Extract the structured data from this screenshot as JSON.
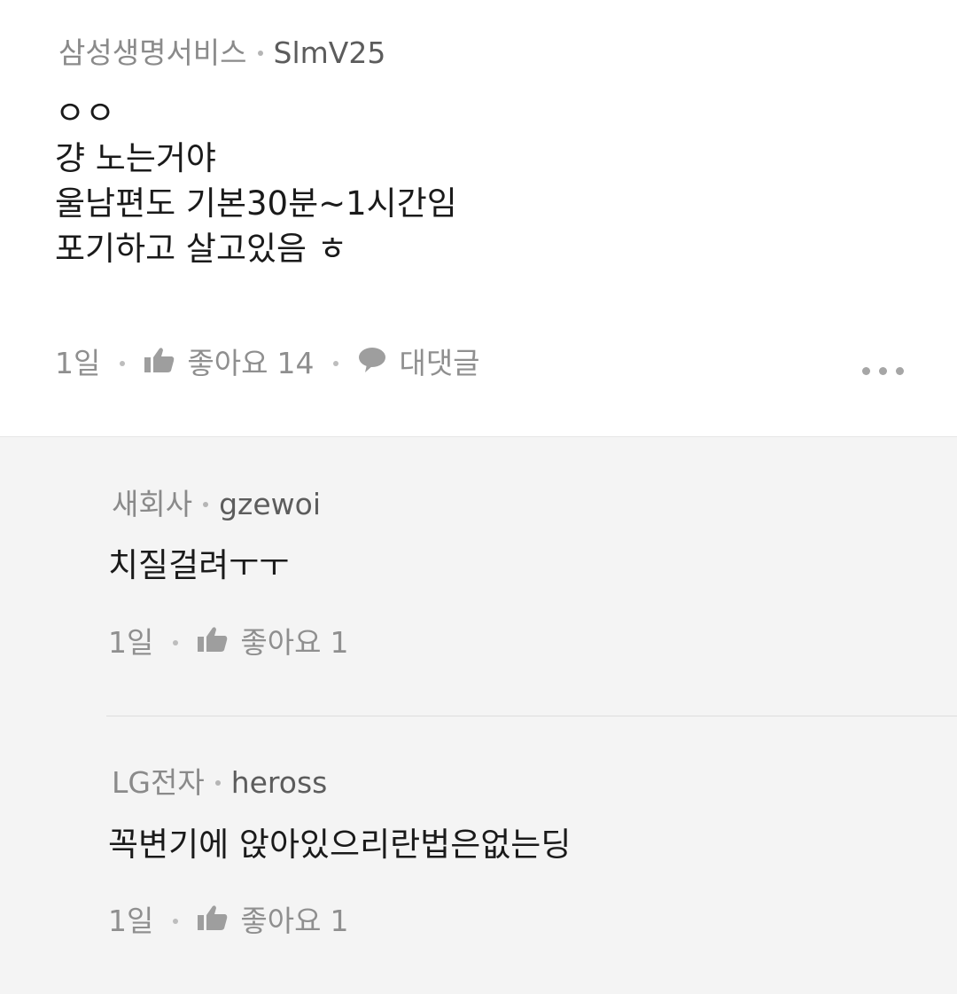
{
  "main_comment": {
    "company": "삼성생명서비스",
    "user_id": "SlmV25",
    "lines": [
      "ㅇㅇ",
      "걍 노는거야",
      "울남편도 기본30분~1시간임",
      "포기하고 살고있음 ㅎ"
    ],
    "time": "1일",
    "like_label": "좋아요",
    "like_count": "14",
    "reply_label": "대댓글",
    "icons": {
      "like": "thumbs-up-icon",
      "reply": "speech-bubble-icon",
      "more": "more-dots-icon"
    }
  },
  "replies": [
    {
      "company": "새회사",
      "user_id": "gzewoi",
      "text": "치질걸려ㅜㅜ",
      "time": "1일",
      "like_label": "좋아요",
      "like_count": "1"
    },
    {
      "company": "LG전자",
      "user_id": "heross",
      "text": "꼭변기에 앉아있으리란법은없는딩",
      "time": "1일",
      "like_label": "좋아요",
      "like_count": "1"
    }
  ],
  "colors": {
    "meta_gray": "#8f8f8f",
    "reply_bg": "#f4f4f4",
    "icon_gray": "#9e9e9e"
  }
}
